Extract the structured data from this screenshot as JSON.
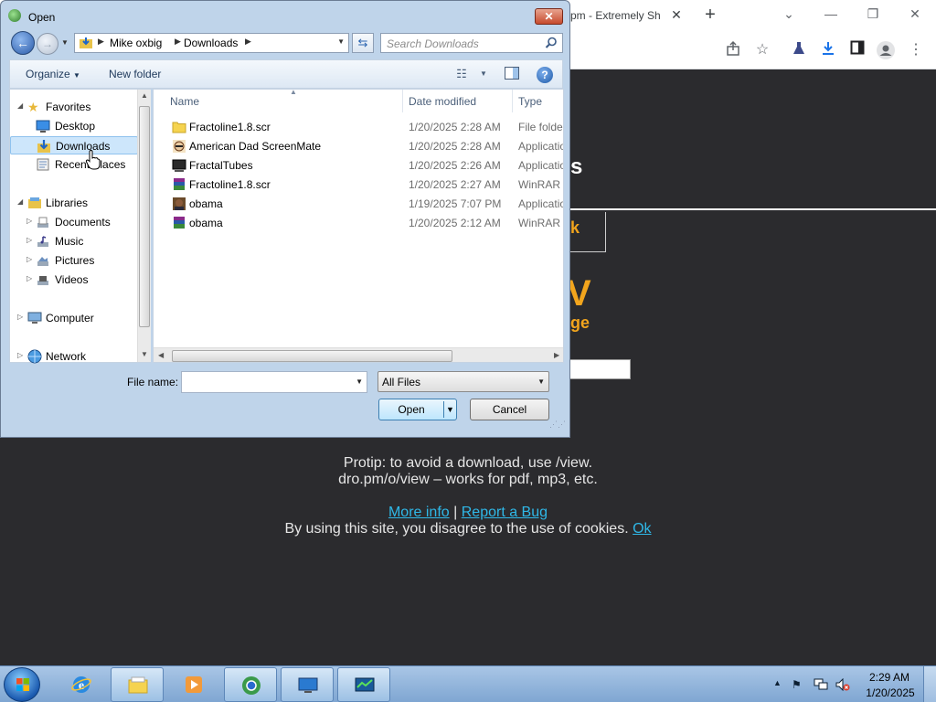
{
  "browser": {
    "tab_title": "pm - Extremely Sh",
    "tab_close": "✕",
    "new_tab": "+",
    "win_min": "—",
    "win_restore": "❐",
    "win_close": "✕",
    "toolbar_icons": [
      "share-icon",
      "star-icon",
      "flask-icon",
      "download-icon",
      "side-panel-icon",
      "profile-icon",
      "menu-icon"
    ]
  },
  "page": {
    "heading_fragment": "s",
    "button_fragment": "k",
    "logo_fragment": "V",
    "tagline_fragment": "ge",
    "protip_line1": "Protip: to avoid a download, use /view.",
    "protip_line2": "dro.pm/o/view – works for pdf, mp3, etc.",
    "more_info": "More info",
    "separator": "|",
    "report_bug": "Report a Bug",
    "cookies_text": "By using this site, you disagree to the use of cookies.",
    "ok_link": "Ok"
  },
  "dialog": {
    "title": "Open",
    "close": "✕",
    "breadcrumb": [
      "Mike oxbig",
      "Downloads"
    ],
    "search_placeholder": "Search Downloads",
    "organize": "Organize",
    "new_folder": "New folder",
    "help": "?",
    "nav_tree": [
      {
        "label": "Favorites",
        "icon": "star-icon",
        "level": 0,
        "expander": "◢"
      },
      {
        "label": "Desktop",
        "icon": "desktop-icon",
        "level": 1
      },
      {
        "label": "Downloads",
        "icon": "downloads-icon",
        "level": 1,
        "selected": true
      },
      {
        "label": "Recent Places",
        "icon": "recent-places-icon",
        "level": 1
      },
      {
        "label": "Libraries",
        "icon": "libraries-icon",
        "level": 0,
        "expander": "◢"
      },
      {
        "label": "Documents",
        "icon": "documents-icon",
        "level": 1,
        "expander": "▷"
      },
      {
        "label": "Music",
        "icon": "music-icon",
        "level": 1,
        "expander": "▷"
      },
      {
        "label": "Pictures",
        "icon": "pictures-icon",
        "level": 1,
        "expander": "▷"
      },
      {
        "label": "Videos",
        "icon": "videos-icon",
        "level": 1,
        "expander": "▷"
      },
      {
        "label": "Computer",
        "icon": "computer-icon",
        "level": 0,
        "expander": "▷"
      },
      {
        "label": "Network",
        "icon": "network-icon",
        "level": 0,
        "expander": "▷"
      }
    ],
    "columns": [
      "Name",
      "Date modified",
      "Type"
    ],
    "files": [
      {
        "name": "Fractoline1.8.scr",
        "date": "1/20/2025 2:28 AM",
        "type": "File folder",
        "icon": "folder-icon"
      },
      {
        "name": "American Dad ScreenMate",
        "date": "1/20/2025 2:28 AM",
        "type": "Application",
        "icon": "app-icon"
      },
      {
        "name": "FractalTubes",
        "date": "1/20/2025 2:26 AM",
        "type": "Application",
        "icon": "app-icon"
      },
      {
        "name": "Fractoline1.8.scr",
        "date": "1/20/2025 2:27 AM",
        "type": "WinRAR ZIP",
        "icon": "winrar-icon"
      },
      {
        "name": "obama",
        "date": "1/19/2025 7:07 PM",
        "type": "Application",
        "icon": "app-icon"
      },
      {
        "name": "obama",
        "date": "1/20/2025 2:12 AM",
        "type": "WinRAR ZIP",
        "icon": "winrar-icon"
      }
    ],
    "file_name_label": "File name:",
    "file_name_value": "",
    "filter_value": "All Files",
    "open_button": "Open",
    "cancel_button": "Cancel"
  },
  "taskbar": {
    "apps": [
      "internet-explorer",
      "file-explorer",
      "media-player",
      "browser",
      "remote-desktop",
      "system-monitor"
    ],
    "clock_time": "2:29 AM",
    "clock_date": "1/20/2025"
  },
  "colors": {
    "dialog_bg": "#bfd4ea",
    "page_bg": "#2b2b2e",
    "accent_orange": "#f2a51d",
    "link_blue": "#2fb8e8",
    "selection": "#cde6fb"
  }
}
